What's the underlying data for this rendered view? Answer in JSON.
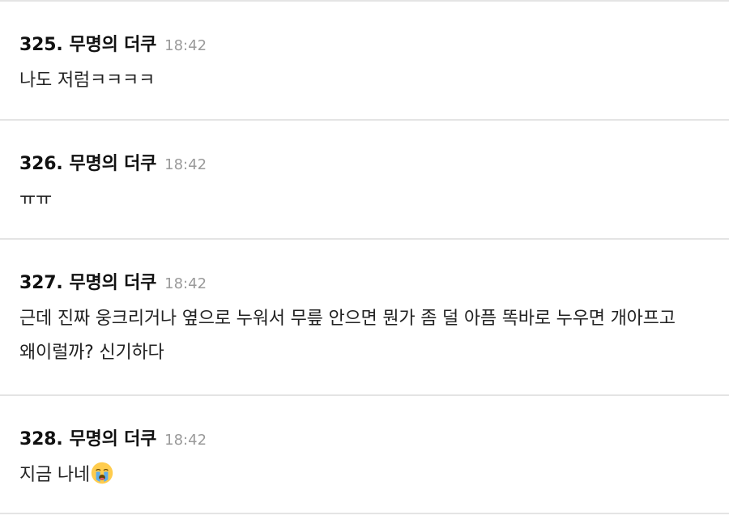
{
  "posts": [
    {
      "number": "325.",
      "author": "무명의 더쿠",
      "time": "18:42",
      "body": "나도 저럼ㅋㅋㅋㅋ"
    },
    {
      "number": "326.",
      "author": "무명의 더쿠",
      "time": "18:42",
      "body": "ㅠㅠ"
    },
    {
      "number": "327.",
      "author": "무명의 더쿠",
      "time": "18:42",
      "body": "근데 진짜 웅크리거나 옆으로 누워서 무릎 안으면 뭔가 좀 덜 아픔 똑바로 누우면 개아프고 왜이럴까? 신기하다"
    },
    {
      "number": "328.",
      "author": "무명의 더쿠",
      "time": "18:42",
      "body": "지금 나네",
      "emoji": "loudly-crying-face-icon"
    }
  ]
}
